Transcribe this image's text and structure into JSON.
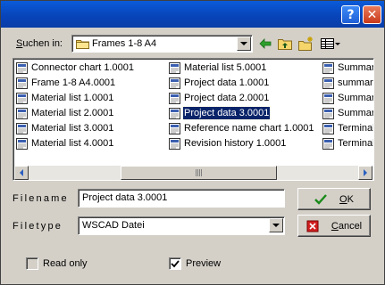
{
  "titlebar": {
    "help_glyph": "?",
    "close_glyph": "✕"
  },
  "lookin": {
    "label_pre": "",
    "label_u": "S",
    "label_post": "uchen in:",
    "value": "Frames 1-8 A4"
  },
  "toolbar": {
    "back_icon": "back-arrow-icon",
    "up_icon": "up-folder-icon",
    "new_icon": "new-folder-icon",
    "view_icon": "view-menu-icon"
  },
  "files": [
    {
      "name": "Connector chart 1.0001"
    },
    {
      "name": "Frame 1-8 A4.0001"
    },
    {
      "name": "Material list 1.0001"
    },
    {
      "name": "Material list 2.0001"
    },
    {
      "name": "Material list 3.0001"
    },
    {
      "name": "Material list 4.0001"
    },
    {
      "name": "Material list 5.0001"
    },
    {
      "name": "Project data 1.0001"
    },
    {
      "name": "Project data 2.0001"
    },
    {
      "name": "Project data 3.0001",
      "selected": true
    },
    {
      "name": "Reference name chart 1.0001"
    },
    {
      "name": "Revision history 1.0001"
    },
    {
      "name": "Summary"
    },
    {
      "name": "summary"
    },
    {
      "name": "Summary"
    },
    {
      "name": "Summary"
    },
    {
      "name": "Terminal"
    },
    {
      "name": "Terminal"
    }
  ],
  "filename": {
    "label": "Filename",
    "value": "Project data 3.0001"
  },
  "filetype": {
    "label": "Filetype",
    "value": "WSCAD Datei"
  },
  "ok_button": {
    "u": "O",
    "rest": "K"
  },
  "cancel_button": {
    "u": "C",
    "rest": "ancel"
  },
  "readonly": {
    "label": "Read only",
    "checked": false,
    "enabled": false
  },
  "preview": {
    "label": "Preview",
    "checked": true
  },
  "colors": {
    "title": "#0a5bd9",
    "selection": "#0a246a",
    "face": "#d4d0c8"
  }
}
